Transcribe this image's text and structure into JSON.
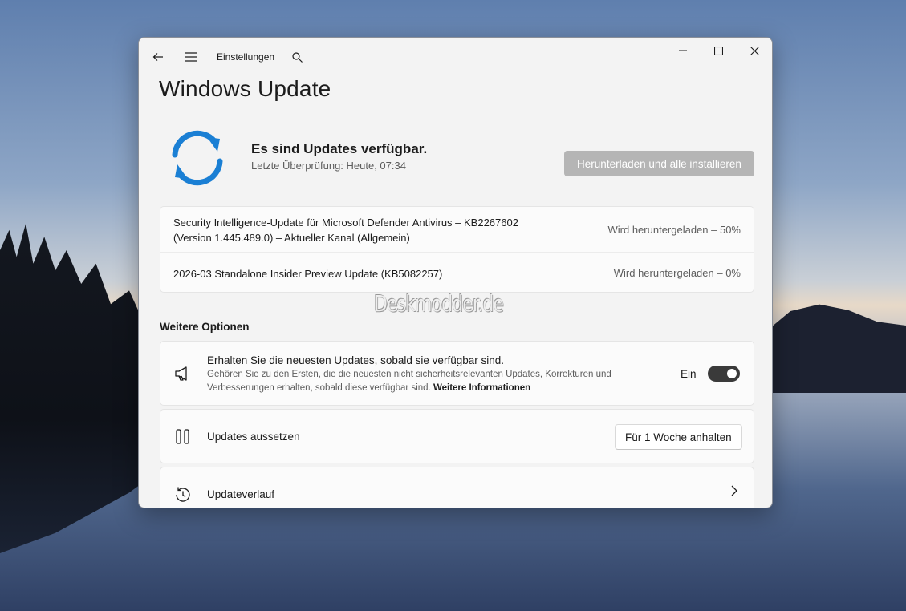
{
  "window": {
    "app_name": "Einstellungen",
    "page_title": "Windows Update",
    "controls": {
      "minimize_icon": "minimize-icon",
      "maximize_icon": "maximize-icon",
      "close_icon": "close-icon"
    }
  },
  "status": {
    "title": "Es sind Updates verfügbar.",
    "last_check": "Letzte Überprüfung: Heute, 07:34",
    "primary_button": "Herunterladen und alle installieren",
    "icon": "sync-icon",
    "icon_color": "#1a7fd4"
  },
  "updates": [
    {
      "name_line1": "Security Intelligence-Update für Microsoft Defender Antivirus – KB2267602",
      "name_line2": "(Version 1.445.489.0) – Aktueller Kanal (Allgemein)",
      "status": "Wird heruntergeladen – 50%"
    },
    {
      "name_line1": "2026-03 Standalone Insider Preview Update (KB5082257)",
      "status": "Wird heruntergeladen – 0%"
    }
  ],
  "more_options": {
    "section_title": "Weitere Optionen",
    "latest_updates": {
      "title": "Erhalten Sie die neuesten Updates, sobald sie verfügbar sind.",
      "desc_line1": "Gehören Sie zu den Ersten, die die neuesten nicht sicherheitsrelevanten Updates, Korrekturen und",
      "desc_line2": "Verbesserungen erhalten, sobald diese verfügbar sind.",
      "link": "Weitere Informationen",
      "toggle_label": "Ein",
      "toggle_on": true
    },
    "pause": {
      "title": "Updates aussetzen",
      "button": "Für 1 Woche anhalten"
    },
    "history": {
      "title": "Updateverlauf"
    }
  },
  "watermark": "Deskmodder.de"
}
